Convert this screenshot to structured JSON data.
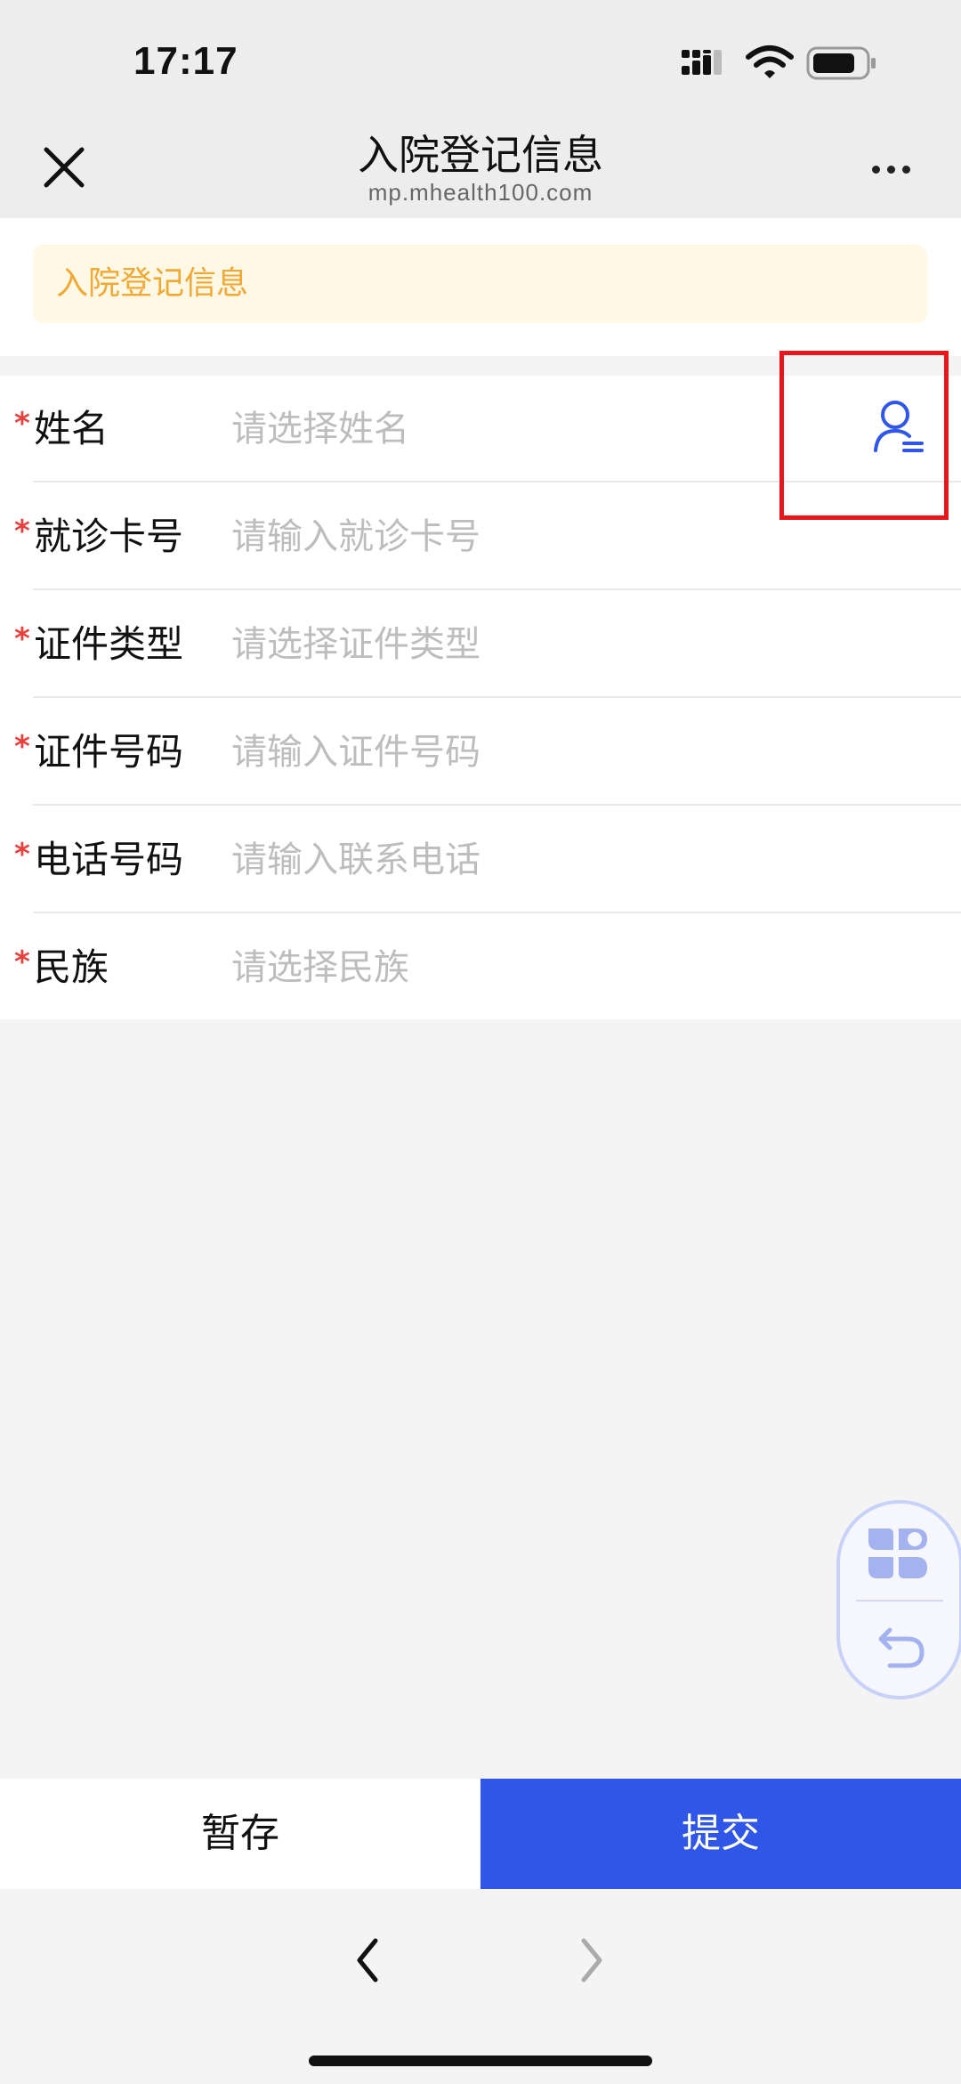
{
  "status_bar": {
    "time": "17:17"
  },
  "nav": {
    "title": "入院登记信息",
    "subtitle": "mp.mhealth100.com"
  },
  "notice": {
    "text": "入院登记信息"
  },
  "form": {
    "rows": [
      {
        "label": "姓名",
        "placeholder": "请选择姓名",
        "required": true
      },
      {
        "label": "就诊卡号",
        "placeholder": "请输入就诊卡号",
        "required": true
      },
      {
        "label": "证件类型",
        "placeholder": "请选择证件类型",
        "required": true
      },
      {
        "label": "证件号码",
        "placeholder": "请输入证件号码",
        "required": true
      },
      {
        "label": "电话号码",
        "placeholder": "请输入联系电话",
        "required": true
      },
      {
        "label": "民族",
        "placeholder": "请选择民族",
        "required": true
      }
    ],
    "required_mark": "*"
  },
  "buttons": {
    "save": "暂存",
    "submit": "提交"
  },
  "colors": {
    "accent": "#3056e8",
    "notice_text": "#f0a936",
    "notice_bg": "#fef8e5",
    "required": "#e8413d",
    "highlight": "#e8151b"
  },
  "icons": {
    "close": "close-icon",
    "more": "more-icon",
    "contact": "contact-select-icon",
    "apps": "apps-icon",
    "undo": "undo-icon",
    "back": "chevron-left-icon",
    "forward": "chevron-right-icon"
  }
}
